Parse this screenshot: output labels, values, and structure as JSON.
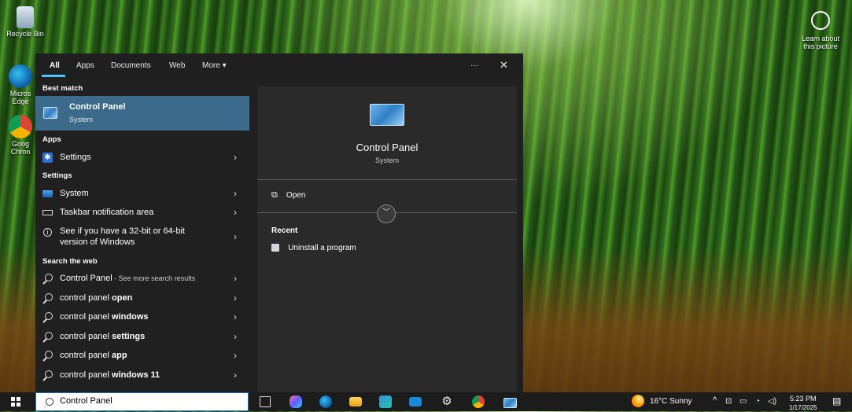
{
  "desktop": {
    "recycle_bin": "Recycle Bin",
    "edge": "Micros Edge",
    "chrome": "Goog Chron",
    "learn_about": "Learn about this picture"
  },
  "filters": {
    "all": "All",
    "apps": "Apps",
    "documents": "Documents",
    "web": "Web",
    "more": "More",
    "ellipsis": "···",
    "close": "✕"
  },
  "left": {
    "best_match_header": "Best match",
    "best": {
      "title": "Control Panel",
      "subtitle": "System"
    },
    "apps_header": "Apps",
    "apps": [
      {
        "label": "Settings"
      }
    ],
    "settings_header": "Settings",
    "settings": [
      {
        "label": "System"
      },
      {
        "label": "Taskbar notification area"
      },
      {
        "label": "See if you have a 32-bit or 64-bit",
        "label2": "version of Windows"
      }
    ],
    "web_header": "Search the web",
    "web": [
      {
        "prefix": "Control Panel",
        "suffix": " - See more search results"
      },
      {
        "prefix": "control panel ",
        "bold": "open"
      },
      {
        "prefix": "control panel ",
        "bold": "windows"
      },
      {
        "prefix": "control panel ",
        "bold": "settings"
      },
      {
        "prefix": "control panel ",
        "bold": "app"
      },
      {
        "prefix": "control panel ",
        "bold": "windows 11"
      }
    ]
  },
  "right": {
    "title": "Control Panel",
    "subtitle": "System",
    "open": "Open",
    "recent_header": "Recent",
    "recent": [
      {
        "label": "Uninstall a program"
      }
    ]
  },
  "taskbar": {
    "search_value": "Control Panel",
    "weather": "16°C  Sunny",
    "time": "5:23 PM",
    "date": "1/17/2025"
  }
}
